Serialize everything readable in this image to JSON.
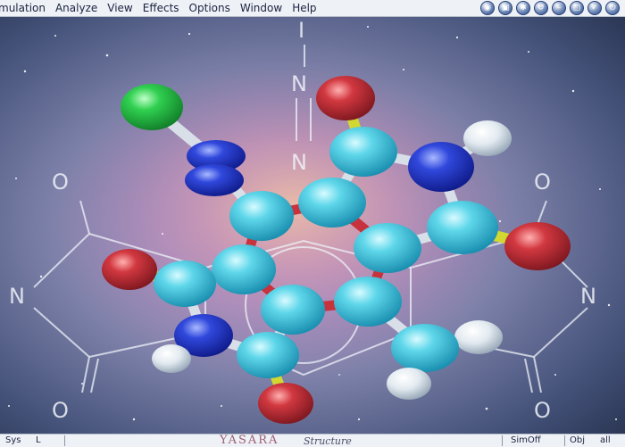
{
  "menu": {
    "items": [
      "mulation",
      "Analyze",
      "View",
      "Effects",
      "Options",
      "Window",
      "Help"
    ]
  },
  "toolbar": {
    "icons": [
      "globe-icon",
      "display-icon",
      "settings-icon",
      "undo-icon",
      "minimize-icon",
      "restore-icon",
      "close-icon",
      "exit-icon"
    ]
  },
  "scene": {
    "formula_letters": [
      "I",
      "N",
      "N",
      "O",
      "O",
      "N",
      "N",
      "O",
      "O"
    ]
  },
  "status": {
    "sys": "Sys",
    "l": "L",
    "logo": "YASARA",
    "logo_sub": "Structure",
    "sim": "SimOff",
    "obj": "Obj",
    "all": "all"
  },
  "colors": {
    "chrome": "#eef1f6",
    "carbon": "#3ec5dc",
    "nitrogen": "#2336c8",
    "oxygen": "#c8323c",
    "chlorine": "#28c846",
    "hydrogen": "#e6eef2",
    "bond_red": "#c8323c",
    "bond_yellow": "#d2d832",
    "bond_grey": "#d8dfe8"
  }
}
